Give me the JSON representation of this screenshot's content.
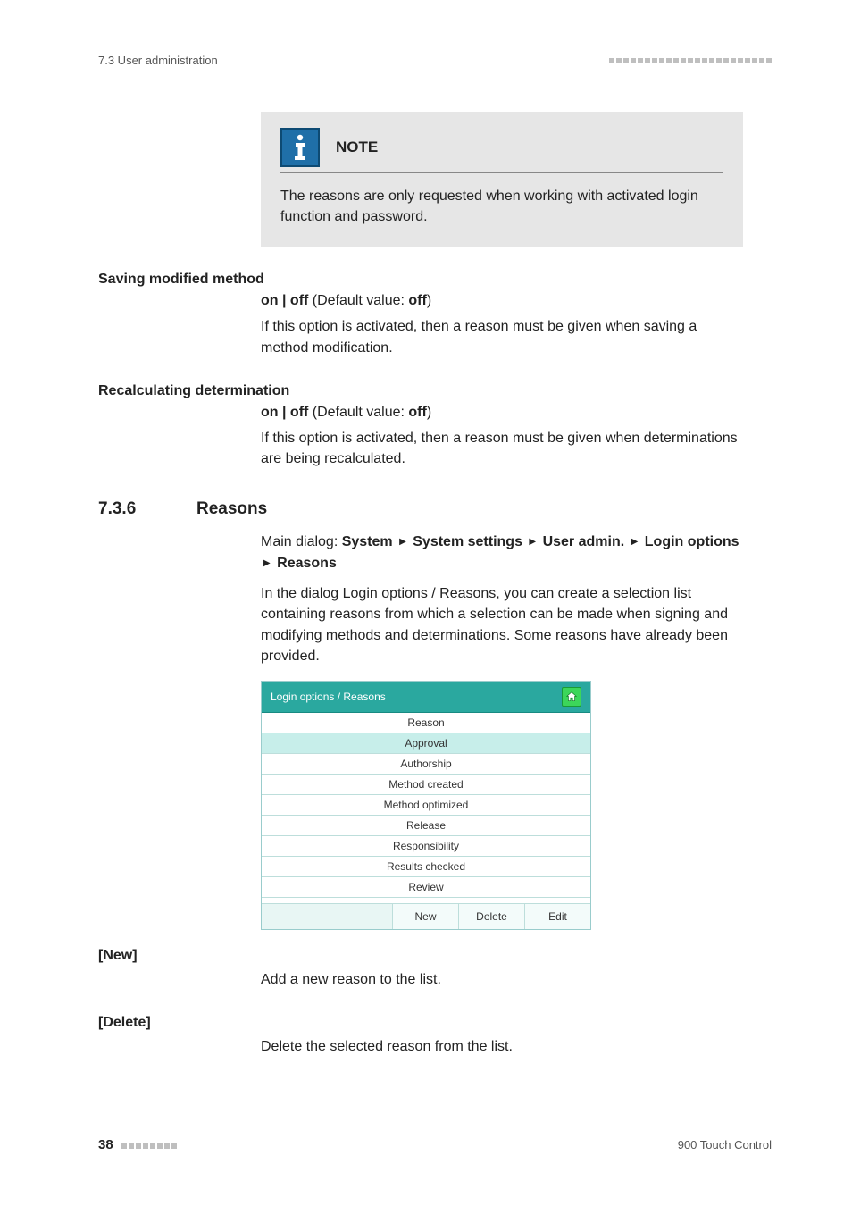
{
  "header": {
    "breadcrumb": "7.3 User administration"
  },
  "note": {
    "title": "NOTE",
    "text": "The reasons are only requested when working with activated login function and password."
  },
  "saving": {
    "heading": "Saving modified method",
    "opts": "on | off",
    "default_label": " (Default value: ",
    "default_value": "off",
    "close": ")",
    "body": "If this option is activated, then a reason must be given when saving a method modification."
  },
  "recalc": {
    "heading": "Recalculating determination",
    "opts": "on | off",
    "default_label": " (Default value: ",
    "default_value": "off",
    "close": ")",
    "body": "If this option is activated, then a reason must be given when determinations are being recalculated."
  },
  "section": {
    "num": "7.3.6",
    "title": "Reasons",
    "nav_prefix": "Main dialog: ",
    "nav_parts": [
      "System",
      "System settings",
      "User admin.",
      "Login options",
      "Reasons"
    ],
    "intro_a": "In the dialog ",
    "intro_bold": "Login options / Reasons",
    "intro_b": ", you can create a selection list containing reasons from which a selection can be made when signing and modifying methods and determinations. Some reasons have already been provided."
  },
  "screenshot": {
    "title": "Login options / Reasons",
    "column": "Reason",
    "rows": [
      "Approval",
      "Authorship",
      "Method created",
      "Method optimized",
      "Release",
      "Responsibility",
      "Results checked",
      "Review"
    ],
    "buttons": {
      "new": "New",
      "delete": "Delete",
      "edit": "Edit"
    }
  },
  "defs": {
    "new_h": "[New]",
    "new_body": "Add a new reason to the list.",
    "del_h": "[Delete]",
    "del_body": "Delete the selected reason from the list."
  },
  "footer": {
    "page": "38",
    "product": "900 Touch Control"
  }
}
